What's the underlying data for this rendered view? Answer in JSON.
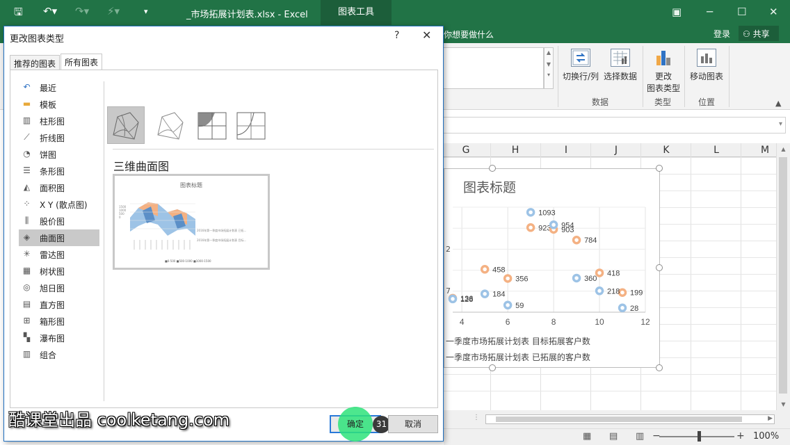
{
  "excel": {
    "window_title": "_市场拓展计划表.xlsx - Excel",
    "context_tab": "图表工具",
    "tell_me": "你想要做什么",
    "login": "登录",
    "share": "共享",
    "ribbon": {
      "switch_row_col": "切换行/列",
      "select_data": "选择数据",
      "change_type_l1": "更改",
      "change_type_l2": "图表类型",
      "move_chart": "移动图表",
      "group_data": "数据",
      "group_type": "类型",
      "group_location": "位置"
    },
    "columns": [
      "G",
      "H",
      "I",
      "J",
      "K",
      "L",
      "M"
    ],
    "zoom": "100%",
    "colors": {
      "brand": "#217346",
      "series_target": "#f4b183",
      "series_done": "#9dc3e6"
    }
  },
  "chart": {
    "title": "图表标题",
    "legend": [
      "一季度市场拓展计划表 目标拓展客户数",
      "一季度市场拓展计划表 已拓展的客户数"
    ],
    "partial_y_labels": [
      "2",
      "7"
    ]
  },
  "chart_data": {
    "type": "scatter",
    "title": "图表标题",
    "xlim": [
      3.6,
      12
    ],
    "x_ticks": [
      "4",
      "6",
      "8",
      "10",
      "12"
    ],
    "series": [
      {
        "name": "一季度市场拓展计划表 目标拓展客户数",
        "color": "#f4b183",
        "points": [
          [
            7,
            923
          ],
          [
            8,
            903
          ],
          [
            9,
            784
          ],
          [
            5,
            458
          ],
          [
            6,
            356
          ],
          [
            10,
            418
          ],
          [
            11,
            199
          ],
          [
            3.6,
            136
          ]
        ],
        "labels": [
          "923",
          "903",
          "784",
          "458",
          "356",
          "418",
          "199",
          "136"
        ]
      },
      {
        "name": "一季度市场拓展计划表 已拓展的客户数",
        "color": "#9dc3e6",
        "points": [
          [
            7,
            1093
          ],
          [
            8,
            954
          ],
          [
            5,
            184
          ],
          [
            6,
            59
          ],
          [
            9,
            360
          ],
          [
            10,
            218
          ],
          [
            11,
            28
          ],
          [
            3.6,
            128
          ]
        ],
        "labels": [
          "1093",
          "954",
          "184",
          "59",
          "360",
          "218",
          "28",
          "128"
        ]
      }
    ]
  },
  "dialog": {
    "title": "更改图表类型",
    "help": "?",
    "close": "✕",
    "tabs": [
      "推荐的图表",
      "所有图表"
    ],
    "active_tab": "所有图表",
    "categories": [
      {
        "label": "最近",
        "icon": "recent-icon",
        "glyph": "↶"
      },
      {
        "label": "模板",
        "icon": "folder-icon",
        "glyph": "▬"
      },
      {
        "label": "柱形图",
        "icon": "column-chart-icon",
        "glyph": "▥"
      },
      {
        "label": "折线图",
        "icon": "line-chart-icon",
        "glyph": "⟋"
      },
      {
        "label": "饼图",
        "icon": "pie-chart-icon",
        "glyph": "◔"
      },
      {
        "label": "条形图",
        "icon": "bar-chart-icon",
        "glyph": "☰"
      },
      {
        "label": "面积图",
        "icon": "area-chart-icon",
        "glyph": "◭"
      },
      {
        "label": "X Y (散点图)",
        "icon": "scatter-chart-icon",
        "glyph": "⁘"
      },
      {
        "label": "股价图",
        "icon": "stock-chart-icon",
        "glyph": "⫼"
      },
      {
        "label": "曲面图",
        "icon": "surface-chart-icon",
        "glyph": "◈"
      },
      {
        "label": "雷达图",
        "icon": "radar-chart-icon",
        "glyph": "✳"
      },
      {
        "label": "树状图",
        "icon": "treemap-icon",
        "glyph": "▦"
      },
      {
        "label": "旭日图",
        "icon": "sunburst-icon",
        "glyph": "◎"
      },
      {
        "label": "直方图",
        "icon": "histogram-icon",
        "glyph": "▤"
      },
      {
        "label": "箱形图",
        "icon": "box-whisker-icon",
        "glyph": "⊞"
      },
      {
        "label": "瀑布图",
        "icon": "waterfall-icon",
        "glyph": "▚"
      },
      {
        "label": "组合",
        "icon": "combo-chart-icon",
        "glyph": "▥"
      }
    ],
    "selected_category": "曲面图",
    "subtype_name": "三维曲面图",
    "preview": {
      "title": "图表标题",
      "y_labels": [
        "1500",
        "1000",
        "500",
        "0"
      ],
      "series_notes": [
        "2016年第一季度市场拓展计划表 已拓...",
        "2016年第一季度市场拓展计划表 目标..."
      ],
      "legend": "■0-500   ■500-1000   ■1000-1500"
    },
    "ok": "确定",
    "cancel": "取消"
  },
  "tutorial": {
    "step": "31",
    "watermark": "酷课堂出品 coolketang.com"
  }
}
